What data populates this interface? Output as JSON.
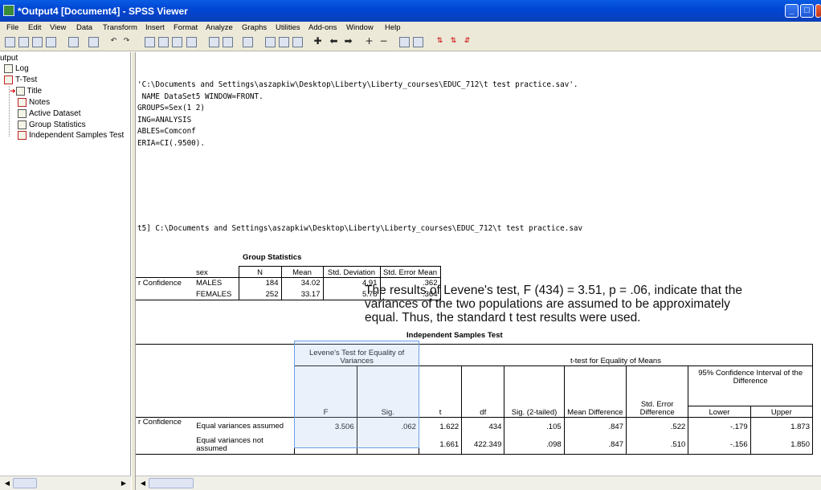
{
  "window": {
    "title": "*Output4 [Document4] - SPSS Viewer"
  },
  "menu": [
    "File",
    "Edit",
    "View",
    "Data",
    "Transform",
    "Insert",
    "Format",
    "Analyze",
    "Graphs",
    "Utilities",
    "Add-ons",
    "Window",
    "Help"
  ],
  "tree": {
    "output": "utput",
    "log": "Log",
    "ttest": "T-Test",
    "title": "Title",
    "notes": "Notes",
    "active": "Active Dataset",
    "group_stats": "Group Statistics",
    "ind_test": "Independent Samples Test"
  },
  "syntax": {
    "line1": "'C:\\Documents and Settings\\aszapkiw\\Desktop\\Liberty\\Liberty_courses\\EDUC_712\\t test practice.sav'.",
    "line2": " NAME DataSet5 WINDOW=FRONT.",
    "line3": "GROUPS=Sex(1 2)",
    "line4": "ING=ANALYSIS",
    "line5": "ABLES=Comconf",
    "line6": "ERIA=CI(.9500).",
    "dataset_line": "t5] C:\\Documents and Settings\\aszapkiw\\Desktop\\Liberty\\Liberty_courses\\EDUC_712\\t test practice.sav"
  },
  "group_stats": {
    "title": "Group Statistics",
    "headers": {
      "sex": "sex",
      "n": "N",
      "mean": "Mean",
      "sd": "Std. Deviation",
      "se": "Std. Error Mean"
    },
    "row_label": "r Confidence",
    "rows": [
      {
        "group": "MALES",
        "n": "184",
        "mean": "34.02",
        "sd": "4.91",
        "se": ".362"
      },
      {
        "group": "FEMALES",
        "n": "252",
        "mean": "33.17",
        "sd": "5.78",
        "se": ".364"
      }
    ]
  },
  "ind_test": {
    "title": "Independent Samples Test",
    "levene_header": "Levene's Test for Equality of Variances",
    "ttest_header": "t-test for Equality of Means",
    "ci_header": "95% Confidence Interval of the Difference",
    "cols": {
      "f": "F",
      "sig": "Sig.",
      "t": "t",
      "df": "df",
      "sig2": "Sig. (2-tailed)",
      "mean_diff": "Mean Difference",
      "se_diff": "Std. Error Difference",
      "lower": "Lower",
      "upper": "Upper"
    },
    "row_label": "r Confidence",
    "rows": [
      {
        "label": "Equal variances assumed",
        "f": "3.506",
        "sig": ".062",
        "t": "1.622",
        "df": "434",
        "sig2": ".105",
        "mean_diff": ".847",
        "se_diff": ".522",
        "lower": "-.179",
        "upper": "1.873"
      },
      {
        "label": "Equal variances not assumed",
        "f": "",
        "sig": "",
        "t": "1.661",
        "df": "422.349",
        "sig2": ".098",
        "mean_diff": ".847",
        "se_diff": ".510",
        "lower": "-.156",
        "upper": "1.850"
      }
    ]
  },
  "overlay_text": "The results of Levene's test, F (434) = 3.51, p = .06, indicate that the variances of the two populations are assumed to be approximately equal. Thus, the standard t test results were used."
}
